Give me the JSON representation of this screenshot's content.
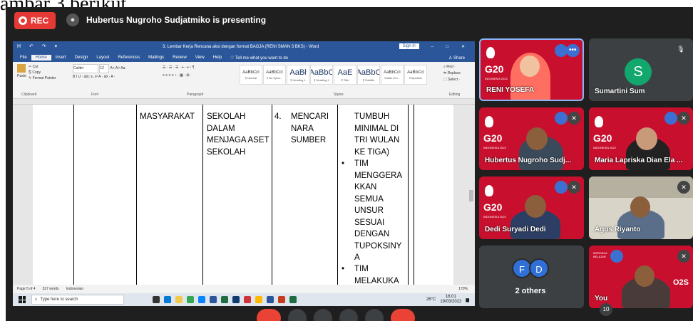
{
  "caption": "ambar 3 berikut.",
  "meeting": {
    "rec_label": "REC",
    "presenter_text": "Hubertus Nugroho Sudjatmiko is presenting",
    "others_count_badge": "10"
  },
  "word": {
    "title": "3. Lembar Kerja Rencana aksi dengan format BAGJA (RENI SMAN 3 BKS) - Word",
    "sign_in": "Sign in",
    "quick_access": "H ↶ ↷ ▾",
    "window_controls": "▭ – □ ✕",
    "tabs": [
      "File",
      "Home",
      "Insert",
      "Design",
      "Layout",
      "References",
      "Mailings",
      "Review",
      "View",
      "Help",
      "♡ Tell me what you want to do"
    ],
    "share": "♙ Share",
    "ribbon": {
      "clipboard": "Clipboard",
      "paste": "Paste",
      "cut": "✂ Cut",
      "copy": "⎘ Copy",
      "format_painter": "✎ Format Painter",
      "font_group": "Font",
      "font_name": "Calibri",
      "font_size": "12",
      "font_row2": "B I U · abc x₂ x²  A · ab · A ·",
      "paragraph_group": "Paragraph",
      "para_row1": "☰ · ☰ · ☰ ·  ⇤ ⇥  ↕ ¶",
      "para_row2": "≡ ≡ ≡ ≡  ↕ ·  ▦ · ⊞ ·",
      "styles_group": "Styles",
      "styles": [
        {
          "preview": "AaBbCcI",
          "name": "¶ Normal",
          "big": false
        },
        {
          "preview": "AaBbCcI",
          "name": "¶ No Spac...",
          "big": false
        },
        {
          "preview": "AaBł",
          "name": "¶ Heading 1",
          "big": true
        },
        {
          "preview": "AaBbC",
          "name": "¶ Heading 2",
          "big": true
        },
        {
          "preview": "AaE",
          "name": "¶ Title",
          "big": true
        },
        {
          "preview": "AaBbC",
          "name": "¶ Subtitle",
          "big": true
        },
        {
          "preview": "AaBbCcI",
          "name": "Subtle Em...",
          "big": false
        },
        {
          "preview": "AaBbCcI",
          "name": "Emphasis",
          "big": false
        }
      ],
      "editing_group": "Editing",
      "find": "⌕ Find ·",
      "replace": "⇆ Replace",
      "select": "⬚ Select ·"
    },
    "document": {
      "col1": "MASYARAKAT",
      "col2": [
        "SEKOLAH",
        "DALAM",
        "MENJAGA ASET",
        "SEKOLAH"
      ],
      "col3_num": "4.",
      "col3": [
        "MENCARI",
        "NARA",
        "SUMBER"
      ],
      "col4_top": [
        "TUMBUH",
        "MINIMAL DI",
        "TRI WULAN",
        "KE TIGA)"
      ],
      "col4_bullet1": [
        "TIM",
        "MENGGERA",
        "KKAN",
        "SEMUA",
        "UNSUR",
        "SESUAI",
        "DENGAN",
        "TUPOKSINY",
        "A"
      ],
      "col4_bullet2": [
        "TIM",
        "MELAKUKA"
      ],
      "bullet": "•"
    },
    "status": {
      "page": "Page 5 of 4",
      "words": "527 words",
      "lang": "Indonesian",
      "zoom": "170%"
    },
    "taskbar": {
      "search_placeholder": "Type here to search",
      "weather": "26°C",
      "time": "16:01",
      "date": "19/03/2022"
    }
  },
  "tiles": {
    "reni": "RENI YOSEFA",
    "sumartini": "Sumartini Sum",
    "sumartini_initial": "S",
    "hubertus": "Hubertus Nugroho Sudj...",
    "maria": "Maria Lapriska Dian Ela ...",
    "dedi": "Dedi Suryadi Dedi",
    "agus": "Agus Riyanto",
    "others": "2 others",
    "others_initials": [
      "F",
      "D"
    ],
    "you": "You",
    "more_badge": "•••",
    "g20_text": "G20",
    "g20_sub": "INDONESIA 2022",
    "code": "O2S",
    "merdeka": "MERDEKA BELAJAR"
  }
}
